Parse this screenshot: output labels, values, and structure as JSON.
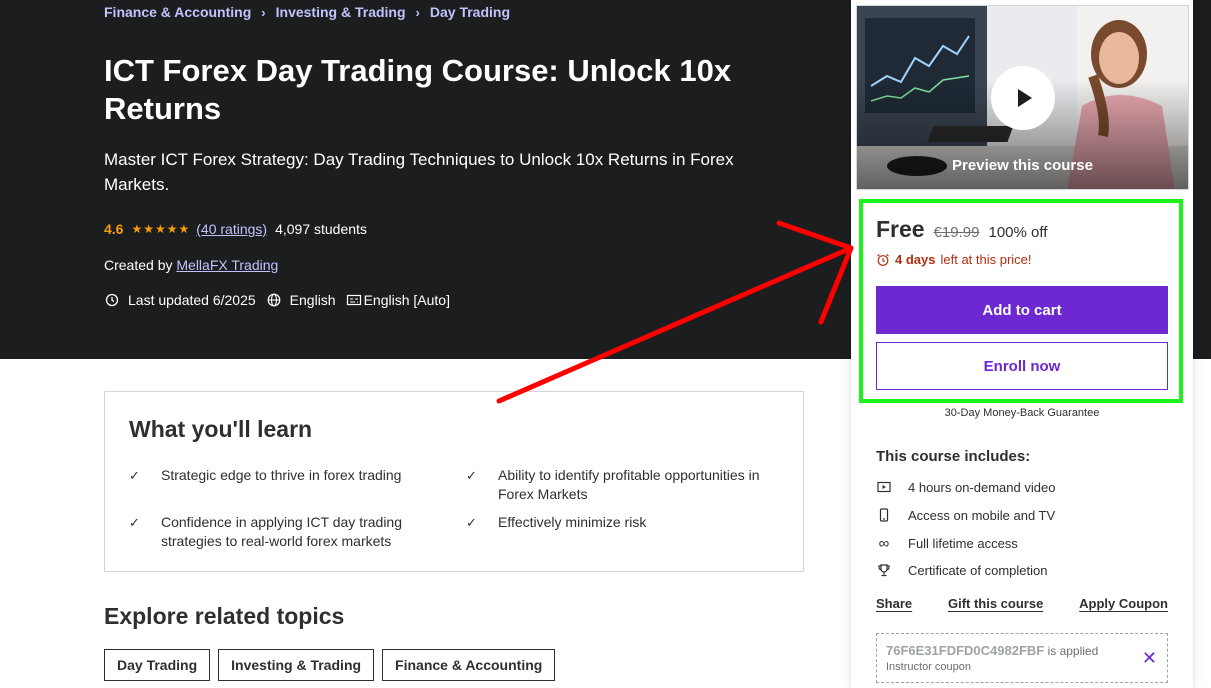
{
  "breadcrumbs": [
    "Finance & Accounting",
    "Investing & Trading",
    "Day Trading"
  ],
  "course": {
    "title": "ICT Forex Day Trading Course: Unlock 10x Returns",
    "subtitle": "Master ICT Forex Strategy: Day Trading Techniques to Unlock 10x Returns in Forex Markets.",
    "rating": "4.6",
    "rating_value": 4.6,
    "stars": "★★★★★",
    "ratings_count": "(40 ratings)",
    "students": "4,097 students",
    "created_by_label": "Created by",
    "instructor": "MellaFX Trading",
    "last_updated": "Last updated 6/2025",
    "language": "English",
    "captions": "English [Auto]"
  },
  "learn": {
    "title": "What you'll learn",
    "items": [
      "Strategic edge to thrive in forex trading",
      "Ability to identify profitable opportunities in Forex Markets",
      "Confidence in applying ICT day trading strategies to real-world forex markets",
      "Effectively minimize risk"
    ]
  },
  "related": {
    "title": "Explore related topics",
    "topics": [
      "Day Trading",
      "Investing & Trading",
      "Finance & Accounting"
    ]
  },
  "sidebar": {
    "preview_label": "Preview this course",
    "price": "Free",
    "original_price": "€19.99",
    "discount": "100% off",
    "timer_bold": "4 days",
    "timer_rest": "left at this price!",
    "add_to_cart": "Add to cart",
    "enroll_now": "Enroll now",
    "guarantee": "30-Day Money-Back Guarantee",
    "includes_title": "This course includes:",
    "includes": [
      {
        "icon": "video-icon",
        "label": "4 hours on-demand video"
      },
      {
        "icon": "mobile-icon",
        "label": "Access on mobile and TV"
      },
      {
        "icon": "infinity-icon",
        "label": "Full lifetime access"
      },
      {
        "icon": "trophy-icon",
        "label": "Certificate of completion"
      }
    ],
    "share": "Share",
    "gift": "Gift this course",
    "apply_coupon": "Apply Coupon",
    "coupon_code": "76F6E31FDFD0C4982FBF",
    "coupon_applied": "is applied",
    "coupon_sub": "Instructor coupon"
  },
  "colors": {
    "hero_bg": "#1c1d1f",
    "accent_purple": "#6d28d2",
    "star_orange": "#f69c08",
    "highlight_green": "#1cf21c",
    "annotation_red": "#ff0000",
    "timer_red": "#b32d0f"
  }
}
